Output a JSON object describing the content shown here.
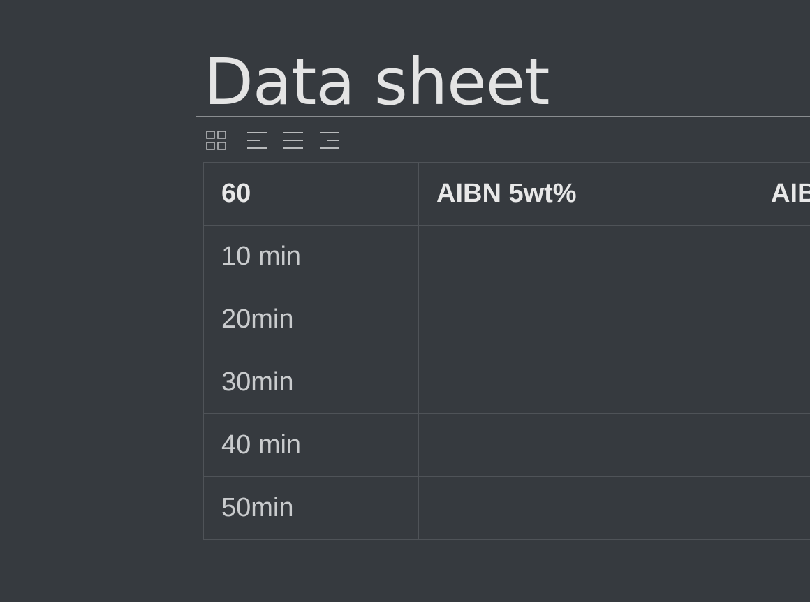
{
  "page": {
    "title": "Data sheet"
  },
  "toolbar": {
    "icons": [
      "grid-icon",
      "align-left-icon",
      "align-justify-icon",
      "align-right-icon"
    ]
  },
  "table": {
    "headers": [
      "60",
      "AIBN 5wt%",
      "AIB"
    ],
    "rows": [
      [
        "10 min",
        "",
        ""
      ],
      [
        "20min",
        "",
        ""
      ],
      [
        "30min",
        "",
        ""
      ],
      [
        "40 min",
        "",
        ""
      ],
      [
        "50min",
        "",
        ""
      ]
    ]
  },
  "colors": {
    "background": "#363a3f",
    "border": "#4f5358",
    "title": "#e4e4e4"
  }
}
